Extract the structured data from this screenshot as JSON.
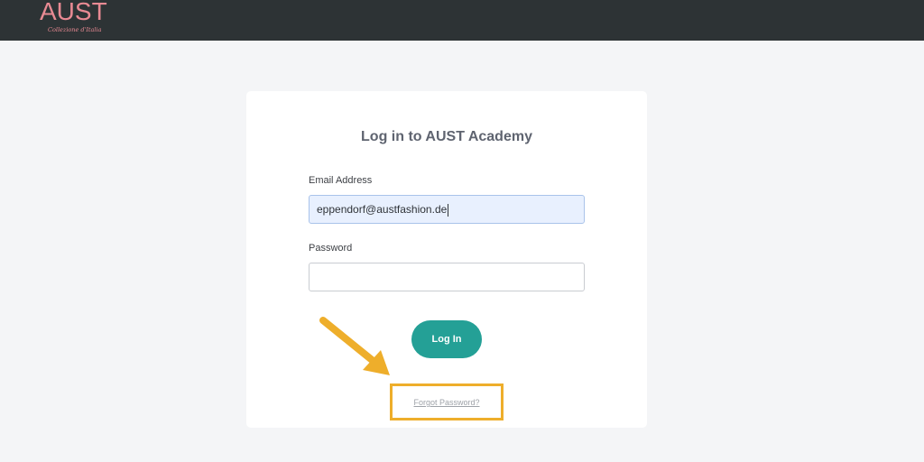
{
  "header": {
    "logo_text": "AUST",
    "logo_tagline": "Collezione d'Italia"
  },
  "login": {
    "title": "Log in to AUST Academy",
    "email_label": "Email Address",
    "email_value": "eppendorf@austfashion.de",
    "password_label": "Password",
    "password_value": "",
    "login_button": "Log In",
    "forgot_link": "Forgot Password?"
  },
  "annotation": {
    "arrow_color": "#eeae2b",
    "highlight_color": "#eeae2b"
  },
  "colors": {
    "topbar": "#2d3335",
    "brand_pink": "#e88a93",
    "button_teal": "#24a096",
    "page_bg": "#f4f5f7"
  }
}
